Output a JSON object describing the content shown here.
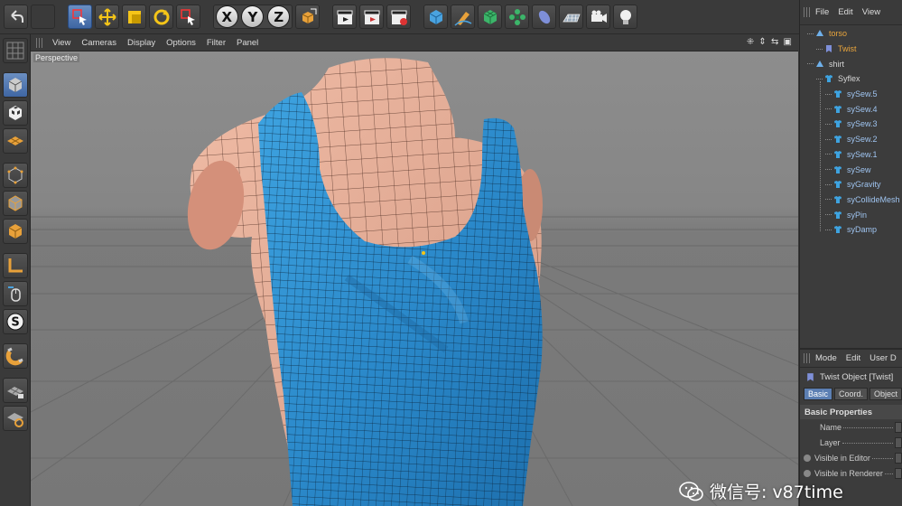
{
  "top_toolbar": {
    "axis_buttons": [
      "X",
      "Y",
      "Z"
    ]
  },
  "viewport": {
    "menu": [
      "View",
      "Cameras",
      "Display",
      "Options",
      "Filter",
      "Panel"
    ],
    "camera_label": "Perspective",
    "nav_icons": "⁜ ⇕ ⇆ ▣"
  },
  "object_manager": {
    "menu": [
      "File",
      "Edit",
      "View"
    ],
    "tree": [
      {
        "label": "torso",
        "depth": 0,
        "color": "orange",
        "icon": "polygon-object-icon"
      },
      {
        "label": "Twist",
        "depth": 1,
        "color": "orange",
        "icon": "twist-deformer-icon"
      },
      {
        "label": "shirt",
        "depth": 0,
        "color": "normal",
        "icon": "polygon-object-icon"
      },
      {
        "label": "Syflex",
        "depth": 1,
        "color": "normal",
        "icon": "syflex-shirt-icon"
      },
      {
        "label": "sySew.5",
        "depth": 2,
        "color": "blue",
        "icon": "syflex-shirt-icon"
      },
      {
        "label": "sySew.4",
        "depth": 2,
        "color": "blue",
        "icon": "syflex-shirt-icon"
      },
      {
        "label": "sySew.3",
        "depth": 2,
        "color": "blue",
        "icon": "syflex-shirt-icon"
      },
      {
        "label": "sySew.2",
        "depth": 2,
        "color": "blue",
        "icon": "syflex-shirt-icon"
      },
      {
        "label": "sySew.1",
        "depth": 2,
        "color": "blue",
        "icon": "syflex-shirt-icon"
      },
      {
        "label": "sySew",
        "depth": 2,
        "color": "blue",
        "icon": "syflex-shirt-icon"
      },
      {
        "label": "syGravity",
        "depth": 2,
        "color": "blue",
        "icon": "syflex-shirt-icon"
      },
      {
        "label": "syCollideMesh",
        "depth": 2,
        "color": "blue",
        "icon": "syflex-shirt-icon"
      },
      {
        "label": "syPin",
        "depth": 2,
        "color": "blue",
        "icon": "syflex-shirt-icon"
      },
      {
        "label": "syDamp",
        "depth": 2,
        "color": "blue",
        "icon": "syflex-shirt-icon"
      }
    ]
  },
  "attribute_manager": {
    "menu": [
      "Mode",
      "Edit",
      "User D"
    ],
    "title": "Twist Object [Twist]",
    "tabs": [
      "Basic",
      "Coord.",
      "Object"
    ],
    "active_tab": "Basic",
    "section": "Basic Properties",
    "fields": [
      {
        "label": "Name",
        "radio": false
      },
      {
        "label": "Layer",
        "radio": false
      },
      {
        "label": "Visible in Editor",
        "radio": true
      },
      {
        "label": "Visible in Renderer",
        "radio": true
      }
    ]
  },
  "watermark": {
    "text": "微信号: v87time"
  },
  "colors": {
    "selection_blue": "#4a72b0",
    "shirt_blue": "#2f8fd0",
    "torso_skin": "#e4a992",
    "tree_orange": "#e9a53c"
  }
}
